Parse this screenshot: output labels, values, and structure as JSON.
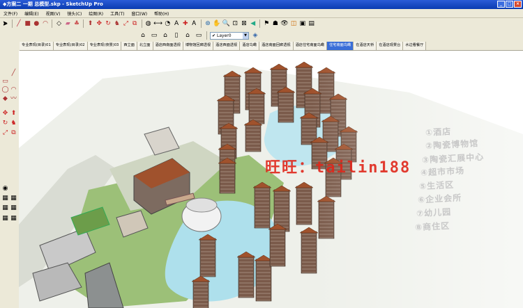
{
  "window": {
    "title": "◆方案二 一期 总模型.skp - SketchUp Pro"
  },
  "menu": [
    "文件(F)",
    "编辑(E)",
    "视图(V)",
    "镜头(C)",
    "绘图(R)",
    "工具(T)",
    "窗口(W)",
    "帮助(H)"
  ],
  "toolbar": {
    "tools": [
      "select-arrow-icon",
      "pencil-line-icon",
      "rectangle-icon",
      "circle-icon",
      "arc-icon",
      "eraser-icon",
      "paint-bucket-icon",
      "push-pull-icon",
      "move-icon",
      "rotate-icon",
      "follow-me-icon",
      "scale-icon",
      "offset-icon",
      "tape-measure-icon",
      "dimension-icon",
      "protractor-icon",
      "text-icon",
      "axes-icon",
      "3d-text-icon",
      "orbit-icon",
      "pan-icon",
      "zoom-icon",
      "zoom-window-icon",
      "zoom-extents-icon",
      "previous-view-icon",
      "next-view-icon",
      "position-camera-icon",
      "walk-icon",
      "look-around-icon",
      "section-plane-icon"
    ],
    "views": [
      "iso-view-icon",
      "top-view-icon",
      "front-view-icon",
      "right-view-icon",
      "back-view-icon",
      "left-view-icon"
    ],
    "layer": {
      "label": "Layer0",
      "checked": "✔"
    }
  },
  "scene_tabs": [
    "专业表现(目录)01",
    "专业表现(目录)02",
    "专业表现(夜景)03",
    "西立面",
    "北立面",
    "酒店西南面透视",
    "博物馆回廊透视",
    "酒店西面透视",
    "酒店鸟瞰",
    "酒店南面回廊透视",
    "酒店住宅南面鸟瞰",
    "住宅南面鸟瞰",
    "在酒店天桥",
    "在酒店观景台",
    "水边看餐厅"
  ],
  "active_tab_index": 11,
  "model_legend": [
    "①酒店",
    "②陶瓷博物馆",
    "③陶瓷汇展中心",
    "④超市市场",
    "⑤生活区",
    "⑥企业会所",
    "⑦幼儿园",
    "⑧商住区"
  ],
  "watermark": "旺旺：tailin188",
  "colors": {
    "titlebar": "#0a3bb0",
    "active_tab": "#3a6ed8",
    "watermark": "#e0261a",
    "roof": "#a0522d",
    "tower": "#7a5a4a",
    "water": "#aee0ec",
    "grass": "#7fb05a"
  }
}
